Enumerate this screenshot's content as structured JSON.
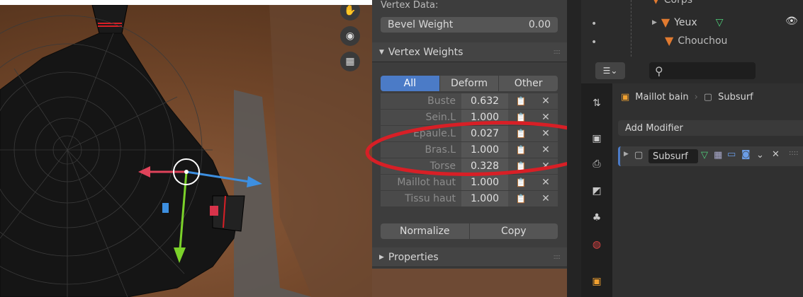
{
  "viewport": {
    "nav_icons": [
      "hand-icon",
      "camera-icon",
      "grid-icon"
    ]
  },
  "sidebar_panel": {
    "vertex_data_label": "Vertex Data:",
    "bevel_weight_label": "Bevel Weight",
    "bevel_weight_value": "0.00",
    "vertex_weights_title": "Vertex Weights",
    "tabs": [
      "All",
      "Deform",
      "Other"
    ],
    "active_tab": "All",
    "weights": [
      {
        "name": "Buste",
        "value": "0.632"
      },
      {
        "name": "Sein.L",
        "value": "1.000"
      },
      {
        "name": "Epaule.L",
        "value": "0.027"
      },
      {
        "name": "Bras.L",
        "value": "1.000"
      },
      {
        "name": "Torse",
        "value": "0.328"
      },
      {
        "name": "Maillot haut",
        "value": "1.000"
      },
      {
        "name": "Tissu haut",
        "value": "1.000"
      }
    ],
    "normalize_label": "Normalize",
    "copy_label": "Copy",
    "properties_title": "Properties"
  },
  "outliner": {
    "items": [
      {
        "label": "Corps",
        "icon": "mesh-icon"
      },
      {
        "label": "Yeux",
        "icon": "mesh-icon"
      },
      {
        "label": "Chouchou",
        "icon": "mesh-icon"
      }
    ]
  },
  "properties": {
    "search_placeholder": "",
    "breadcrumb_object": "Maillot bain",
    "breadcrumb_modifier": "Subsurf",
    "add_modifier_label": "Add Modifier",
    "modifier_name": "Subsurf"
  },
  "colors": {
    "accent": "#4b7bc7",
    "annotation": "#d81f26",
    "gizmo_x": "#e0435a",
    "gizmo_y": "#7bd12a",
    "gizmo_z": "#3d8fe0"
  }
}
